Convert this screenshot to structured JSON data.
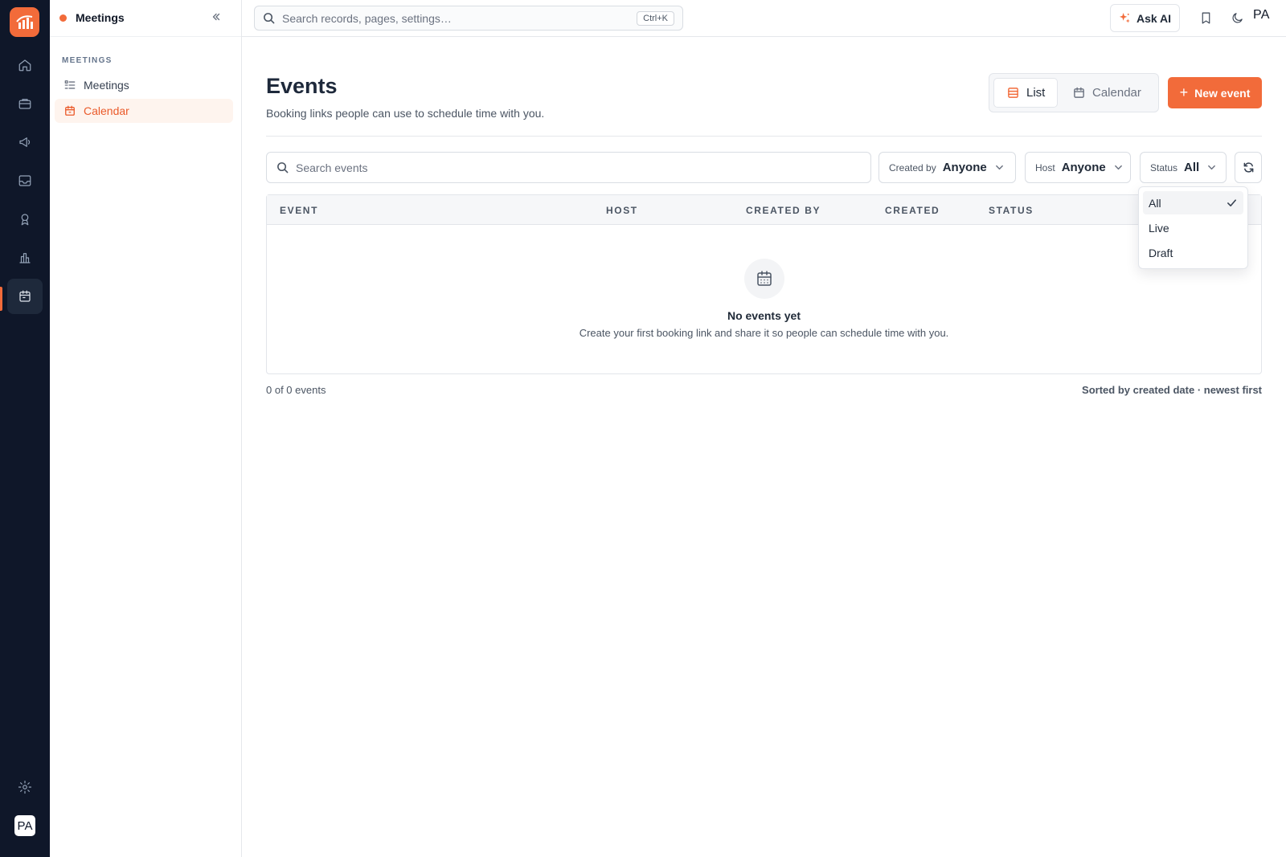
{
  "colors": {
    "accent": "#f26b3a",
    "rail": "#0f1729"
  },
  "rail": {
    "items": [
      "home-icon",
      "briefcase-icon",
      "megaphone-icon",
      "inbox-icon",
      "award-icon",
      "bar-chart-icon",
      "calendar-icon"
    ],
    "avatar": "PA"
  },
  "sidebar": {
    "title": "Meetings",
    "section": "MEETINGS",
    "items": [
      {
        "label": "Meetings",
        "icon": "list-icon"
      },
      {
        "label": "Calendar",
        "icon": "calendar-icon"
      }
    ]
  },
  "topbar": {
    "search_placeholder": "Search records, pages, settings…",
    "shortcut": "Ctrl+K",
    "ask_ai": "Ask AI",
    "avatar": "PA"
  },
  "main": {
    "title": "Events",
    "subtitle": "Booking links people can use to schedule time with you.",
    "view_list": "List",
    "view_calendar": "Calendar",
    "new_event": "New event",
    "search_placeholder": "Search events",
    "filters": {
      "created_by": {
        "label": "Created by",
        "value": "Anyone"
      },
      "host": {
        "label": "Host",
        "value": "Anyone"
      },
      "status": {
        "label": "Status",
        "value": "All"
      }
    },
    "columns": [
      "EVENT",
      "HOST",
      "CREATED BY",
      "CREATED",
      "STATUS"
    ],
    "empty_title": "No events yet",
    "empty_sub": "Create your first booking link and share it so people can schedule time with you.",
    "count": "0 of 0 events",
    "sort": "Sorted by created date · newest first"
  },
  "status_dropdown": {
    "options": [
      "All",
      "Live",
      "Draft"
    ],
    "selected": "All"
  }
}
